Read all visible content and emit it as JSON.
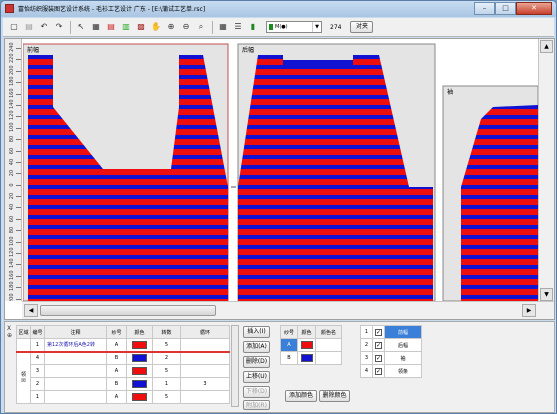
{
  "window": {
    "title": "富怡纺织服装图艺设计系统 - 毛衫工艺设计 广东 - [E:\\蒲试工艺单.rsc]",
    "min_label": "–",
    "max_label": "□",
    "close_label": "✕"
  },
  "toolbar": {
    "yarn_combo_value": "M(●)",
    "count_value": "274",
    "align_button": "对夹",
    "icons": [
      "new-icon",
      "open-icon",
      "undo-icon",
      "redo-icon",
      "select-arrow-icon",
      "text-icon",
      "chart-icon",
      "color-table-icon",
      "grid-color-icon",
      "hand-icon",
      "zoom-in-icon",
      "zoom-out-icon",
      "zoom-icon",
      "table-icon",
      "ruler-icon",
      "yarn-icon"
    ]
  },
  "colors": {
    "red": "#ef0e0e",
    "blue": "#1212d2",
    "panel_bg": "#e4e4e4",
    "selection": "#3a7fd8"
  },
  "canvas": {
    "ruler_ticks": [
      "240",
      "220",
      "200",
      "180",
      "160",
      "140",
      "120",
      "100",
      "80",
      "60",
      "40",
      "20",
      "0",
      "20",
      "40",
      "60",
      "80",
      "100",
      "120",
      "140",
      "160",
      "180",
      "200"
    ],
    "panels": [
      {
        "label": "前幅"
      },
      {
        "label": "后幅"
      },
      {
        "label": "袖"
      }
    ]
  },
  "bottom": {
    "pin_label": "X\n⊕",
    "table": {
      "headers": [
        "区域",
        "编号",
        "注释",
        "纱号",
        "颜色",
        "转数",
        "循环"
      ],
      "region_label": "领",
      "rows": [
        {
          "num": "1",
          "note": "第12次循环后A色2转",
          "yarn": "A",
          "color": "#ef0e0e",
          "turns": "5",
          "cycle": ""
        },
        {
          "num": "4",
          "note": "",
          "yarn": "B",
          "color": "#1212d2",
          "turns": "2",
          "cycle": ""
        },
        {
          "num": "3",
          "note": "",
          "yarn": "A",
          "color": "#ef0e0e",
          "turns": "5",
          "cycle": ""
        },
        {
          "num": "2",
          "note": "",
          "yarn": "B",
          "color": "#1212d2",
          "turns": "1",
          "cycle": "3"
        },
        {
          "num": "1",
          "note": "",
          "yarn": "A",
          "color": "#ef0e0e",
          "turns": "5",
          "cycle": ""
        }
      ]
    },
    "actions": [
      "插入(I)",
      "添加(A)",
      "删除(D)",
      "上移(U)",
      "下移(D)",
      "附加(R)"
    ],
    "yarn_table": {
      "headers": [
        "纱号",
        "颜色",
        "颜色名"
      ],
      "rows": [
        {
          "yarn": "A",
          "color": "#ef0e0e",
          "name": ""
        },
        {
          "yarn": "B",
          "color": "#1212d2",
          "name": ""
        }
      ]
    },
    "yarn_buttons": {
      "add": "添加颜色",
      "delete": "删除颜色"
    },
    "part_list": [
      {
        "num": "1",
        "checked": true,
        "name": "前幅"
      },
      {
        "num": "2",
        "checked": true,
        "name": "后幅"
      },
      {
        "num": "3",
        "checked": true,
        "name": "袖"
      },
      {
        "num": "4",
        "checked": true,
        "name": "领条"
      }
    ]
  }
}
